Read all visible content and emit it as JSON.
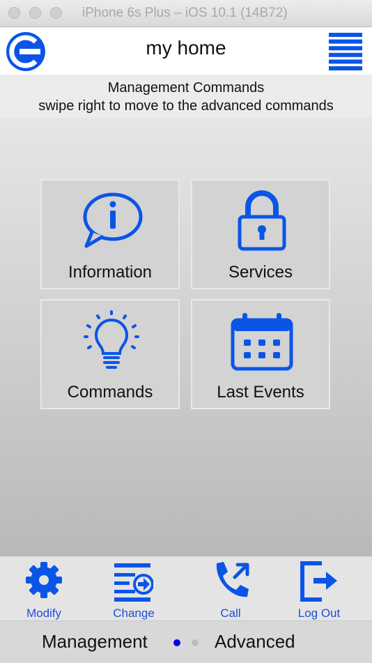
{
  "window": {
    "title": "iPhone 6s Plus – iOS 10.1 (14B72)"
  },
  "header": {
    "title": "my home",
    "logo_icon": "e-logo-icon",
    "menu_icon": "hamburger-menu-icon"
  },
  "subheader": {
    "line1": "Management Commands",
    "line2": "swipe right to move to the advanced commands"
  },
  "tiles": [
    {
      "label": "Information",
      "icon": "info-speech-bubble-icon"
    },
    {
      "label": "Services",
      "icon": "padlock-icon"
    },
    {
      "label": "Commands",
      "icon": "light-bulb-icon"
    },
    {
      "label": "Last Events",
      "icon": "calendar-icon"
    }
  ],
  "toolbar": {
    "items": [
      {
        "label": "Modify",
        "icon": "gear-icon"
      },
      {
        "label": "Change",
        "icon": "list-arrow-icon"
      },
      {
        "label": "Call",
        "icon": "phone-call-icon"
      },
      {
        "label": "Log Out",
        "icon": "logout-icon"
      }
    ]
  },
  "pager": {
    "left_label": "Management",
    "right_label": "Advanced",
    "active_page": 1,
    "page_count": 2
  },
  "colors": {
    "accent": "#0a55e8",
    "toolbar_label": "#1f4ed8",
    "dot_active": "#0000ee",
    "dot_inactive": "#bdbdbd"
  }
}
